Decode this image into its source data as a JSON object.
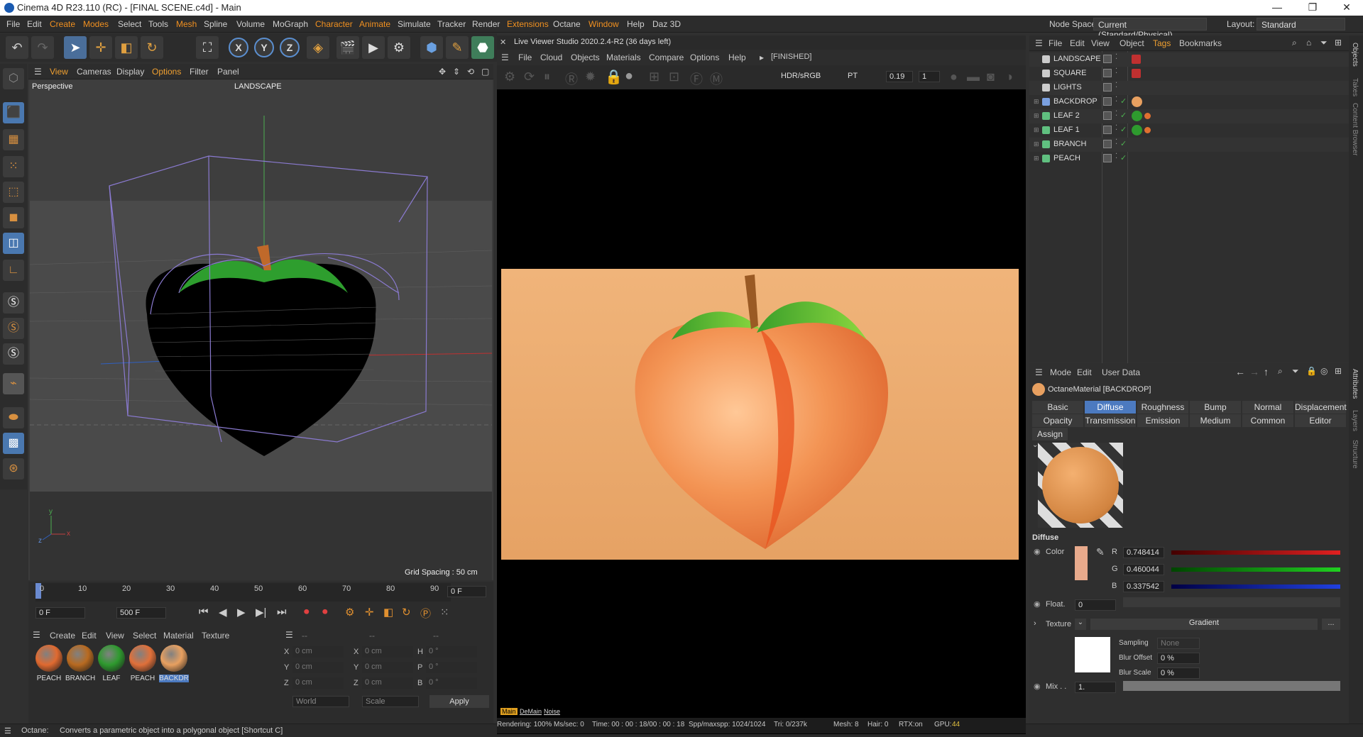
{
  "titlebar": {
    "title": "Cinema 4D R23.110 (RC) - [FINAL SCENE.c4d] - Main",
    "min": "—",
    "max": "❐",
    "close": "✕"
  },
  "menubar": {
    "items": [
      "File",
      "Edit",
      "Create",
      "Modes",
      "Select",
      "Tools",
      "Mesh",
      "Spline",
      "Volume",
      "MoGraph",
      "Character",
      "Animate",
      "Simulate",
      "Tracker",
      "Render",
      "Extensions",
      "Octane",
      "Window",
      "Help",
      "Daz 3D"
    ],
    "node_space_label": "Node Space:",
    "node_space_value": "Current (Standard/Physical)",
    "layout_label": "Layout:",
    "layout_value": "Standard"
  },
  "toolbar": {
    "axes": [
      "X",
      "Y",
      "Z"
    ]
  },
  "viewport": {
    "menu": [
      "View",
      "Cameras",
      "Display",
      "Options",
      "Filter",
      "Panel"
    ],
    "camera_label": "Perspective",
    "object_label": "LANDSCAPE",
    "grid_spacing": "Grid Spacing : 50 cm",
    "axis_x": "x",
    "axis_y": "y",
    "axis_z": "z"
  },
  "timeline": {
    "ticks": [
      "0",
      "10",
      "20",
      "30",
      "40",
      "50",
      "60",
      "70",
      "80",
      "90"
    ],
    "frame_right": "0 F",
    "start": "0 F",
    "end": "500 F"
  },
  "materials": {
    "menu": [
      "Create",
      "Edit",
      "View",
      "Select",
      "Material",
      "Texture"
    ],
    "items": [
      {
        "name": "PEACH",
        "color": "#e06a30"
      },
      {
        "name": "BRANCH",
        "color": "#b86a20"
      },
      {
        "name": "LEAF",
        "color": "#2e9a2e"
      },
      {
        "name": "PEACH",
        "color": "#e0703a"
      },
      {
        "name": "BACKDR",
        "color": "#e8a060"
      }
    ]
  },
  "coords": {
    "header_dash1": "--",
    "header_dash2": "--",
    "header_dash3": "--",
    "rows": [
      {
        "a": "X",
        "av": "0 cm",
        "b": "X",
        "bv": "0 cm",
        "c": "H",
        "cv": "0 °"
      },
      {
        "a": "Y",
        "av": "0 cm",
        "b": "Y",
        "bv": "0 cm",
        "c": "P",
        "cv": "0 °"
      },
      {
        "a": "Z",
        "av": "0 cm",
        "b": "Z",
        "bv": "0 cm",
        "c": "B",
        "cv": "0 °"
      }
    ],
    "world": "World",
    "scale": "Scale",
    "apply": "Apply"
  },
  "status": {
    "label": "Octane:",
    "text": "Converts a parametric object into a polygonal object [Shortcut C]"
  },
  "liveviewer": {
    "title": "Live Viewer Studio 2020.2.4-R2 (36 days left)",
    "menu": [
      "File",
      "Cloud",
      "Objects",
      "Materials",
      "Compare",
      "Options",
      "Help"
    ],
    "state": "[FINISHED]",
    "colorspace": "HDR/sRGB",
    "kernel": "PT",
    "value1": "0.19",
    "value2": "1",
    "stats": {
      "rendering": "Rendering: 100%",
      "mssec": "Ms/sec: 0",
      "time": "Time: 00 : 00 : 18/00 : 00 : 18",
      "spp": "Spp/maxspp: 1024/1024",
      "tri": "Tri: 0/237k",
      "mesh": "Mesh: 8",
      "hair": "Hair: 0",
      "rtx": "RTX:on",
      "gpu": "GPU:",
      "gpu_val": "44"
    },
    "bottom_tags": [
      "Main",
      "DeMain",
      "Noise"
    ]
  },
  "objects": {
    "menu": [
      "File",
      "Edit",
      "View",
      "Object",
      "Tags",
      "Bookmarks"
    ],
    "rows": [
      {
        "name": "LANDSCAPE",
        "icon": "null-icon"
      },
      {
        "name": "SQUARE",
        "icon": "null-icon"
      },
      {
        "name": "LIGHTS",
        "icon": "light-icon"
      },
      {
        "name": "BACKDROP",
        "icon": "backdrop-icon"
      },
      {
        "name": "LEAF 2",
        "icon": "polygon-icon"
      },
      {
        "name": "LEAF 1",
        "icon": "polygon-icon"
      },
      {
        "name": "BRANCH",
        "icon": "polygon-icon"
      },
      {
        "name": "PEACH",
        "icon": "polygon-icon"
      }
    ]
  },
  "attributes": {
    "menu": [
      "Mode",
      "Edit",
      "User Data"
    ],
    "material_title": "OctaneMaterial [BACKDROP]",
    "tabs_row1": [
      "Basic",
      "Diffuse",
      "Roughness",
      "Bump",
      "Normal",
      "Displacement"
    ],
    "tabs_row2": [
      "Opacity",
      "Transmission",
      "Emission",
      "Medium",
      "Common",
      "Editor"
    ],
    "tab_assign": "Assign",
    "section": "Diffuse",
    "color_label": "Color",
    "r_label": "R",
    "r": "0.748414",
    "g_label": "G",
    "g": "0.460044",
    "b_label": "B",
    "b": "0.337542",
    "float_label": "Float.",
    "float_val": "0",
    "texture_label": "Texture",
    "texture_val": "Gradient",
    "texture_btn": "...",
    "sampling_label": "Sampling",
    "sampling_val": "None",
    "blur_offset_label": "Blur Offset",
    "blur_offset": "0 %",
    "blur_scale_label": "Blur Scale",
    "blur_scale": "0 %",
    "mix_label": "Mix . .",
    "mix_val": "1."
  },
  "right_strip": {
    "top": [
      "Objects",
      "Takes",
      "Content Browser"
    ],
    "bottom": [
      "Attributes",
      "Layers",
      "Structure"
    ]
  },
  "colors": {
    "accent": "#4c7ac0",
    "orange": "#f0a030"
  }
}
